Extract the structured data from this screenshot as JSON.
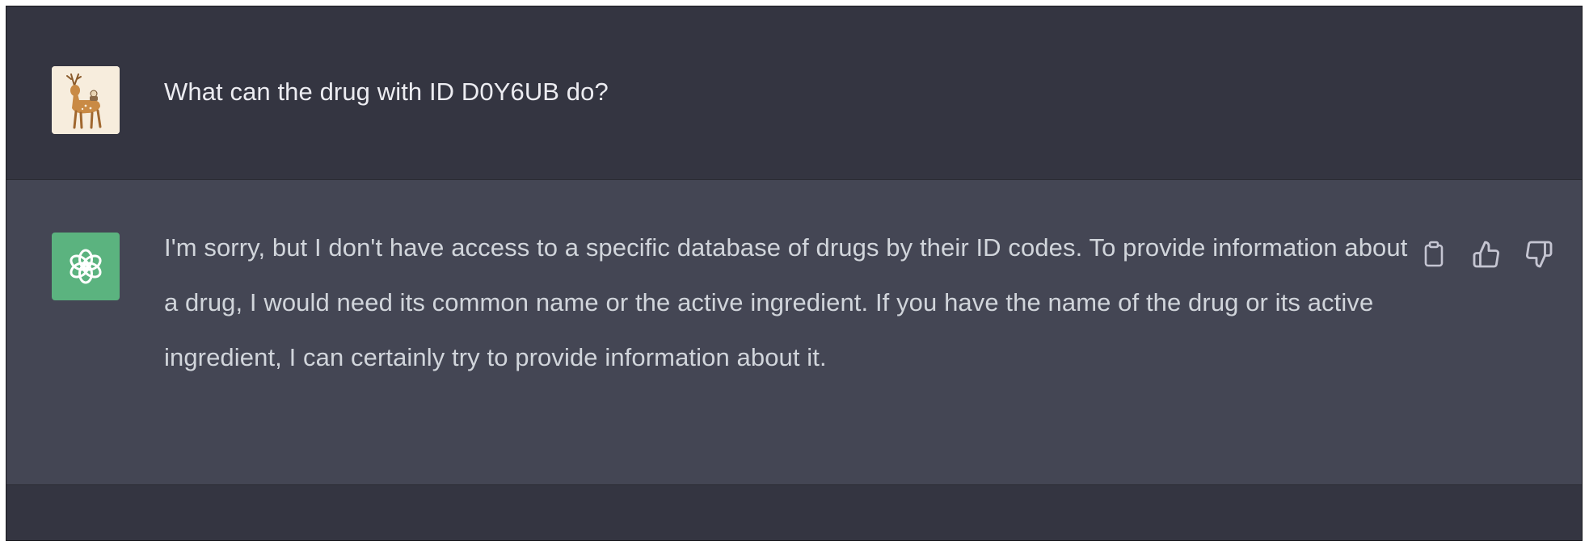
{
  "conversation": {
    "user": {
      "avatar_icon": "deer-avatar-icon",
      "message": "What can the drug with ID D0Y6UB do?"
    },
    "assistant": {
      "avatar_icon": "openai-logo-icon",
      "avatar_color": "#5bb37f",
      "message": "I'm sorry, but I don't have access to a specific database of drugs by their ID codes. To provide information about a drug, I would need its common name or the active ingredient. If you have the name of the drug or its active ingredient, I can certainly try to provide information about it.",
      "actions": [
        "clipboard-icon",
        "thumbs-up-icon",
        "thumbs-down-icon"
      ]
    }
  },
  "colors": {
    "user_bg": "#343541",
    "assistant_bg": "#444654",
    "text": "#ececf1"
  }
}
